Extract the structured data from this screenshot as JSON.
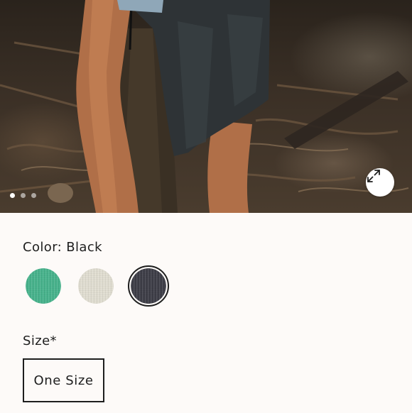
{
  "hero": {
    "image_description_icon": "product-photo",
    "dots": [
      true,
      false,
      false
    ],
    "expand_icon": "expand-arrows-icon"
  },
  "color": {
    "label": "Color: Black",
    "swatches": [
      {
        "name": "mint",
        "hex": "#48b78f",
        "selected": false
      },
      {
        "name": "cream",
        "hex": "#e6e3d6",
        "selected": false
      },
      {
        "name": "black",
        "hex": "#3e3e48",
        "selected": true
      }
    ]
  },
  "size": {
    "label": "Size*",
    "options": [
      {
        "label": "One Size",
        "selected": true
      }
    ]
  }
}
